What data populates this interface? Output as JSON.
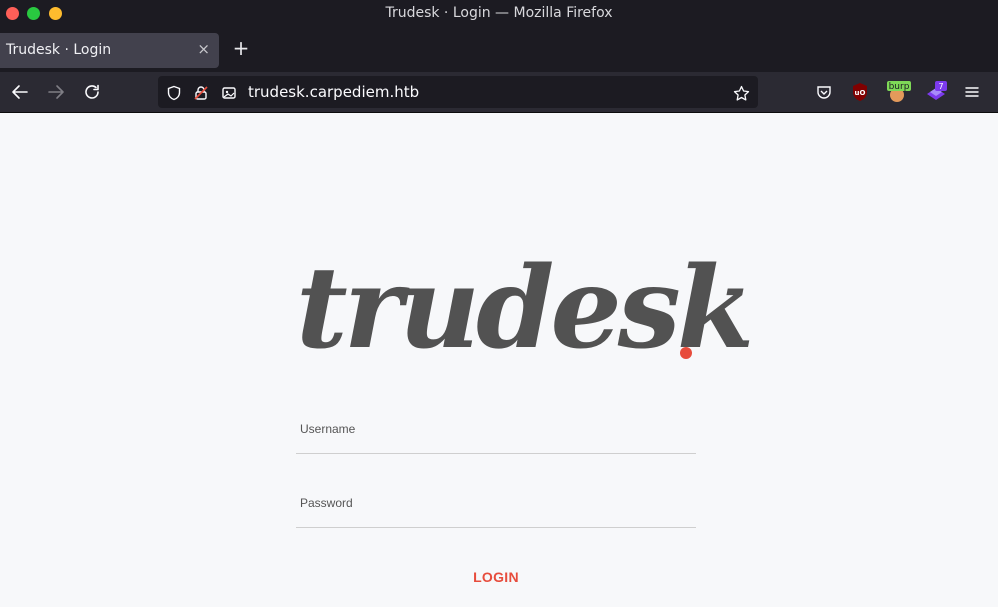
{
  "window": {
    "title": "Trudesk · Login — Mozilla Firefox"
  },
  "tab": {
    "label": "Trudesk · Login",
    "close": "×",
    "new_tab": "+"
  },
  "navbar": {
    "url": "trudesk.carpediem.htb"
  },
  "extensions": {
    "burp_label": "burp",
    "badge_count": "7"
  },
  "page": {
    "logo_text": "trudesk",
    "username_label": "Username",
    "password_label": "Password",
    "login_label": "LOGIN"
  },
  "colors": {
    "accent": "#e74c3c",
    "logo": "#525252",
    "chrome_dark": "#1c1b22",
    "chrome_nav": "#2b2a33"
  }
}
